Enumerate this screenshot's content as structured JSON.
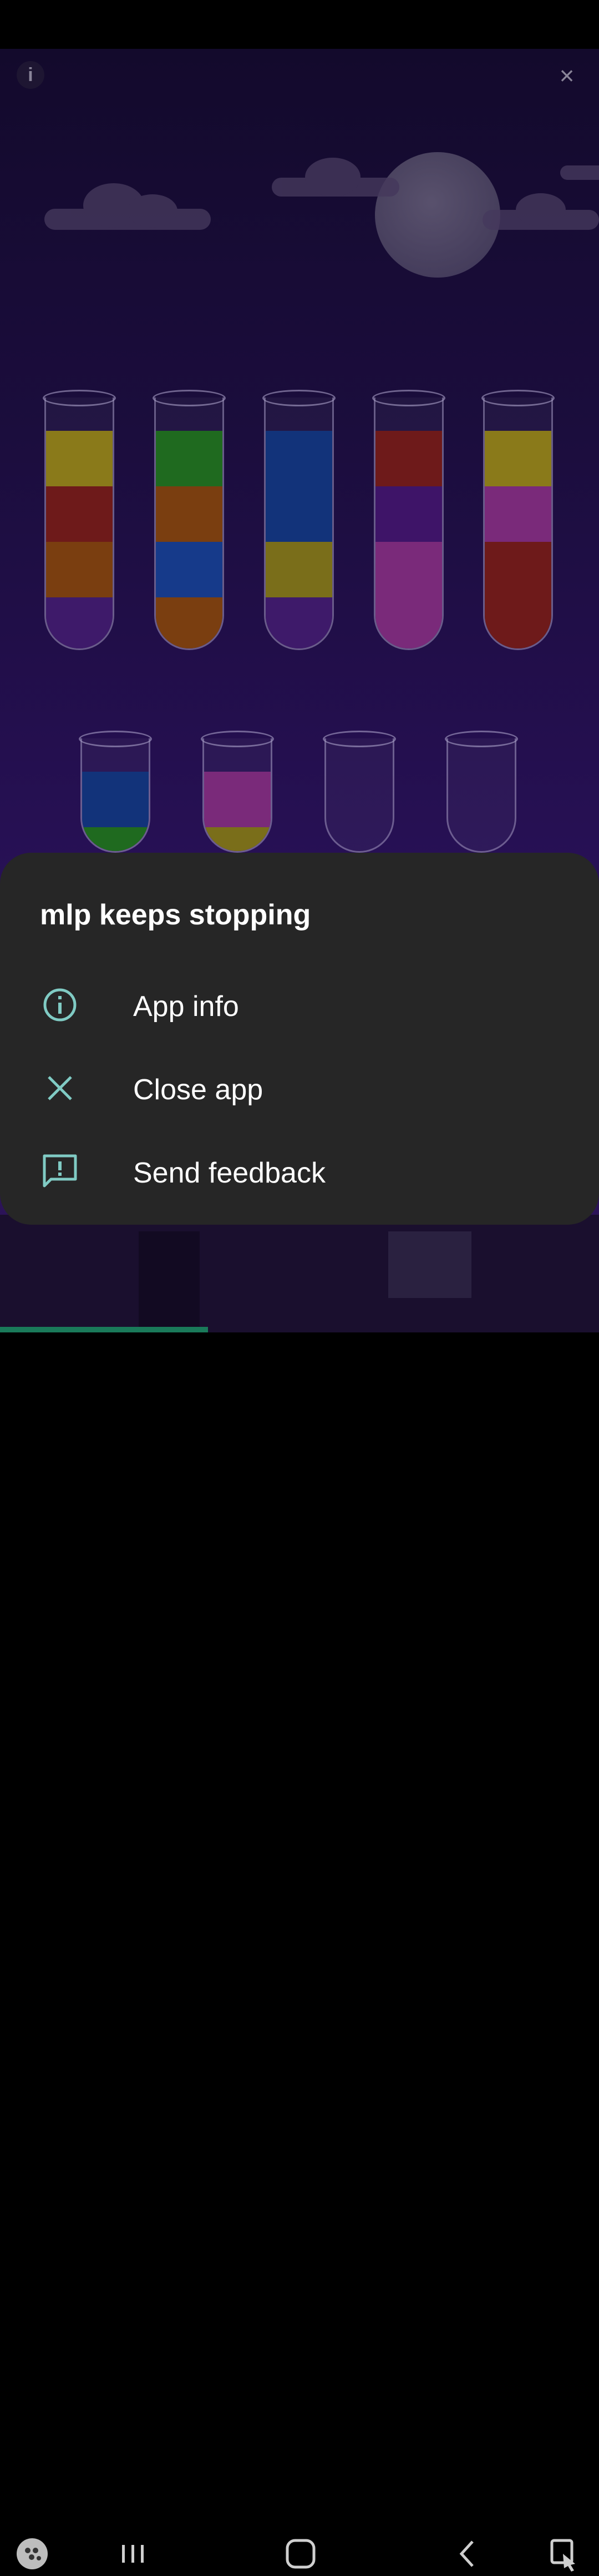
{
  "dialog": {
    "title": "mlp keeps stopping",
    "options": [
      {
        "label": "App info",
        "icon": "info-icon"
      },
      {
        "label": "Close app",
        "icon": "close-icon"
      },
      {
        "label": "Send feedback",
        "icon": "feedback-icon"
      }
    ]
  },
  "game": {
    "info_label": "i",
    "close_label": "×",
    "tubes_top_row": [
      {
        "layers": [
          "#8a7a1a",
          "#6e1a1a",
          "#7a3e10",
          "#3e1a6a"
        ]
      },
      {
        "layers": [
          "#1f6a1f",
          "#7a3e10",
          "#163a8a",
          "#7a3e10"
        ]
      },
      {
        "layers": [
          "#12337a",
          "#12337a",
          "#7a6e1a",
          "#3e1a6a"
        ]
      },
      {
        "layers": [
          "#6e1a1a",
          "#3e1468",
          "#7a2a7a",
          "#7a2a7a"
        ]
      },
      {
        "layers": [
          "#8a7a1a",
          "#7a2a7a",
          "#6e1a1a",
          "#6e1a1a"
        ]
      }
    ],
    "tubes_bottom_row": [
      {
        "layers": [
          "#12337a",
          "#1f6a1f"
        ]
      },
      {
        "layers": [
          "#7a2a7a",
          "#7a6e1a"
        ]
      },
      {
        "layers": []
      },
      {
        "layers": []
      }
    ]
  },
  "colors": {
    "accent_teal": "#80cbc4",
    "dialog_bg": "#262626"
  },
  "navbar": {
    "items": [
      "game-launcher-icon",
      "recent-apps-icon",
      "home-icon",
      "back-icon",
      "gesture-icon"
    ]
  }
}
